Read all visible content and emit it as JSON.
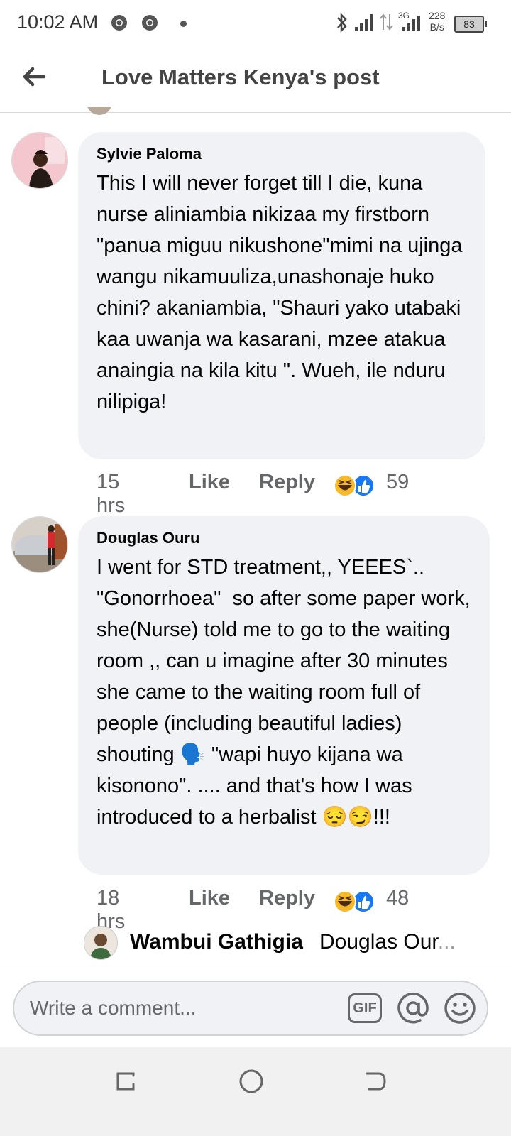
{
  "status_bar": {
    "time": "10:02 AM",
    "network_type": "3G",
    "speed_value": "228",
    "speed_unit": "B/s",
    "battery": "83"
  },
  "header": {
    "title": "Love Matters Kenya's post"
  },
  "comments": [
    {
      "author": "Sylvie Paloma",
      "text": "This I will never forget till I die, kuna nurse aliniambia nikizaa my firstborn \"panua miguu nikushone\"mimi na ujinga wangu nikamuuliza,unashonaje huko chini? akaniambia, \"Shauri yako utabaki kaa uwanja wa kasarani, mzee atakua anaingia na kila kitu \". Wueh, ile nduru nilipiga!",
      "time": "15 hrs",
      "like_label": "Like",
      "reply_label": "Reply",
      "reaction_count": "59"
    },
    {
      "author": "Douglas Ouru",
      "text": "I went for STD treatment,, YEEES`.. \"Gonorrhoea\"  so after some paper work,  she(Nurse) told me to go to the waiting room ,, can u imagine after 30 minutes she came to the waiting room full of  people (including beautiful ladies) shouting 🗣️ \"wapi huyo kijana wa kisonono\". .... and that's how I was introduced to a herbalist 😔😏!!!",
      "time": "18 hrs",
      "like_label": "Like",
      "reply_label": "Reply",
      "reaction_count": "48"
    }
  ],
  "reply_preview": {
    "name": "Wambui Gathigia",
    "text": "Douglas Our",
    "ellipsis": "..."
  },
  "composer": {
    "placeholder": "Write a comment...",
    "gif_label": "GIF"
  },
  "colors": {
    "bubble": "#f0f2f5",
    "secondary_text": "#65676b",
    "like_blue": "#1877f2",
    "haha_yellow": "#f7b928"
  }
}
